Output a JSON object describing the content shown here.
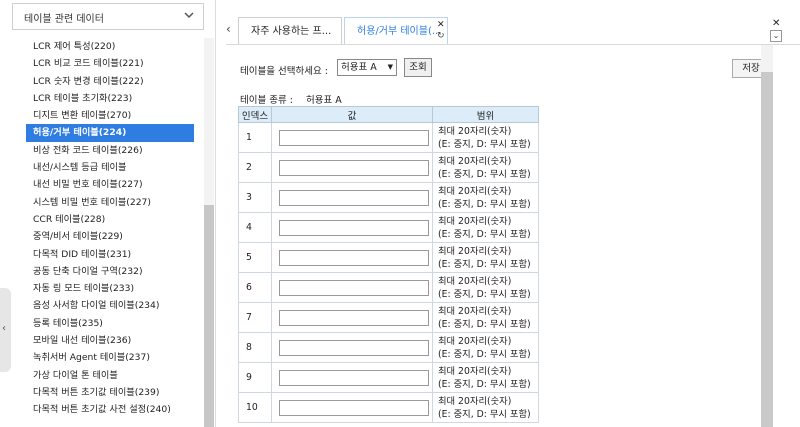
{
  "sidebar": {
    "header": "테이블 관련 데이터",
    "items": [
      "LCR 제어 특성(220)",
      "LCR 비교 코드 테이블(221)",
      "LCR 숫자 변경 테이블(222)",
      "LCR 테이블 초기화(223)",
      "디지트 변환 테이블(270)",
      "허용/거부 테이블(224)",
      "비상 전화 코드 테이블(226)",
      "내선/시스템 등급 테이블",
      "내선 비밀 번호 테이블(227)",
      "시스템 비밀 번호 테이블(227)",
      "CCR 테이블(228)",
      "중역/비서 테이블(229)",
      "다목적 DID 테이블(231)",
      "공동 단축 다이얼 구역(232)",
      "자동 링 모드 테이블(233)",
      "음성 사서함 다이얼 테이블(234)",
      "등록 테이블(235)",
      "모바일 내선 테이블(236)",
      "녹취서버 Agent 테이블(237)",
      "가상 다이얼 톤 테이블",
      "다목적 버튼 초기값 테이블(239)",
      "다목적 버튼 초기값 사전 설정(240)"
    ],
    "active_index": 5
  },
  "tabs": [
    {
      "label": "자주 사용하는 프...",
      "active": false
    },
    {
      "label": "허용/거부 테이블(...",
      "active": true
    }
  ],
  "icons": {
    "chevron": "chevron-down-icon",
    "prev": "chevron-left-icon",
    "close": "close-icon",
    "refresh": "refresh-icon",
    "menu": "window-menu-icon"
  },
  "main": {
    "select_label": "테이블을 선택하세요 :",
    "selected_table": "허용표 A",
    "query_button": "조회",
    "save_button": "저장",
    "type_label": "테이블 종류 :",
    "type_value": "허용표 A",
    "columns": [
      "인덱스",
      "값",
      "범위"
    ],
    "rows": [
      {
        "index": "1",
        "value": "",
        "range_line1": "최대 20자리(숫자)",
        "range_line2": "(E: 중지, D: 무시 포함)"
      },
      {
        "index": "2",
        "value": "",
        "range_line1": "최대 20자리(숫자)",
        "range_line2": "(E: 중지, D: 무시 포함)"
      },
      {
        "index": "3",
        "value": "",
        "range_line1": "최대 20자리(숫자)",
        "range_line2": "(E: 중지, D: 무시 포함)"
      },
      {
        "index": "4",
        "value": "",
        "range_line1": "최대 20자리(숫자)",
        "range_line2": "(E: 중지, D: 무시 포함)"
      },
      {
        "index": "5",
        "value": "",
        "range_line1": "최대 20자리(숫자)",
        "range_line2": "(E: 중지, D: 무시 포함)"
      },
      {
        "index": "6",
        "value": "",
        "range_line1": "최대 20자리(숫자)",
        "range_line2": "(E: 중지, D: 무시 포함)"
      },
      {
        "index": "7",
        "value": "",
        "range_line1": "최대 20자리(숫자)",
        "range_line2": "(E: 중지, D: 무시 포함)"
      },
      {
        "index": "8",
        "value": "",
        "range_line1": "최대 20자리(숫자)",
        "range_line2": "(E: 중지, D: 무시 포함)"
      },
      {
        "index": "9",
        "value": "",
        "range_line1": "최대 20자리(숫자)",
        "range_line2": "(E: 중지, D: 무시 포함)"
      },
      {
        "index": "10",
        "value": "",
        "range_line1": "최대 20자리(숫자)",
        "range_line2": "(E: 중지, D: 무시 포함)"
      }
    ]
  },
  "colors": {
    "accent": "#2f7de1",
    "header_bg": "#dcecf8"
  }
}
